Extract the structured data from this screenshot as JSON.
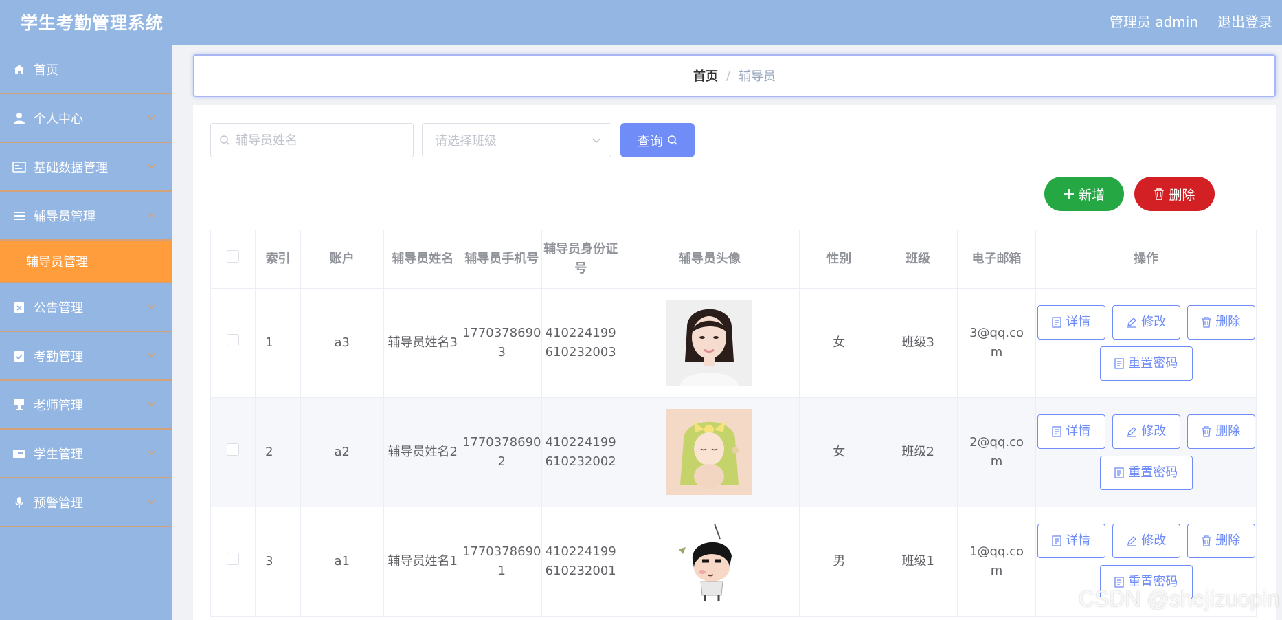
{
  "header": {
    "title": "学生考勤管理系统",
    "user": "管理员 admin",
    "logout": "退出登录"
  },
  "sidebar": {
    "items": [
      {
        "label": "首页",
        "icon": "home-icon"
      },
      {
        "label": "个人中心",
        "icon": "user-icon"
      },
      {
        "label": "基础数据管理",
        "icon": "id-card-icon"
      },
      {
        "label": "辅导员管理",
        "icon": "list-icon",
        "expanded": true,
        "children": [
          "辅导员管理"
        ]
      },
      {
        "label": "公告管理",
        "icon": "clipboard-x-icon"
      },
      {
        "label": "考勤管理",
        "icon": "clipboard-check-icon"
      },
      {
        "label": "老师管理",
        "icon": "podium-icon"
      },
      {
        "label": "学生管理",
        "icon": "card-icon"
      },
      {
        "label": "预警管理",
        "icon": "microphone-icon"
      }
    ],
    "active_child": "辅导员管理",
    "colors": {
      "bg": "#94b6e3",
      "active": "#ff9d3c",
      "divider": "#d3a27a"
    }
  },
  "breadcrumb": {
    "home": "首页",
    "separator": "/",
    "current": "辅导员"
  },
  "search": {
    "name_placeholder": "辅导员姓名",
    "name_value": "",
    "class_placeholder": "请选择班级",
    "query_label": "查询"
  },
  "actions": {
    "add": "新增",
    "delete": "删除"
  },
  "table": {
    "headers": [
      "索引",
      "账户",
      "辅导员姓名",
      "辅导员手机号",
      "辅导员身份证号",
      "辅导员头像",
      "性别",
      "班级",
      "电子邮箱",
      "操作"
    ],
    "rows": [
      {
        "index": "1",
        "account": "a3",
        "name": "辅导员姓名3",
        "phone": "17703786903",
        "id_card": "410224199610232003",
        "avatar": "woman-portrait",
        "gender": "女",
        "class": "班级3",
        "email": "3@qq.com"
      },
      {
        "index": "2",
        "account": "a2",
        "name": "辅导员姓名2",
        "phone": "17703786902",
        "id_card": "410224199610232002",
        "avatar": "anime-girl",
        "gender": "女",
        "class": "班级2",
        "email": "2@qq.com"
      },
      {
        "index": "3",
        "account": "a1",
        "name": "辅导员姓名1",
        "phone": "17703786901",
        "id_card": "410224199610232001",
        "avatar": "cartoon-boy",
        "gender": "男",
        "class": "班级1",
        "email": "1@qq.com"
      }
    ],
    "row_actions": {
      "detail": "详情",
      "edit": "修改",
      "delete": "删除",
      "reset": "重置密码"
    }
  },
  "watermark": "CSDN @shejizuopin",
  "colors": {
    "primary": "#6f8cf7",
    "success": "#25a743",
    "danger": "#d22025"
  }
}
